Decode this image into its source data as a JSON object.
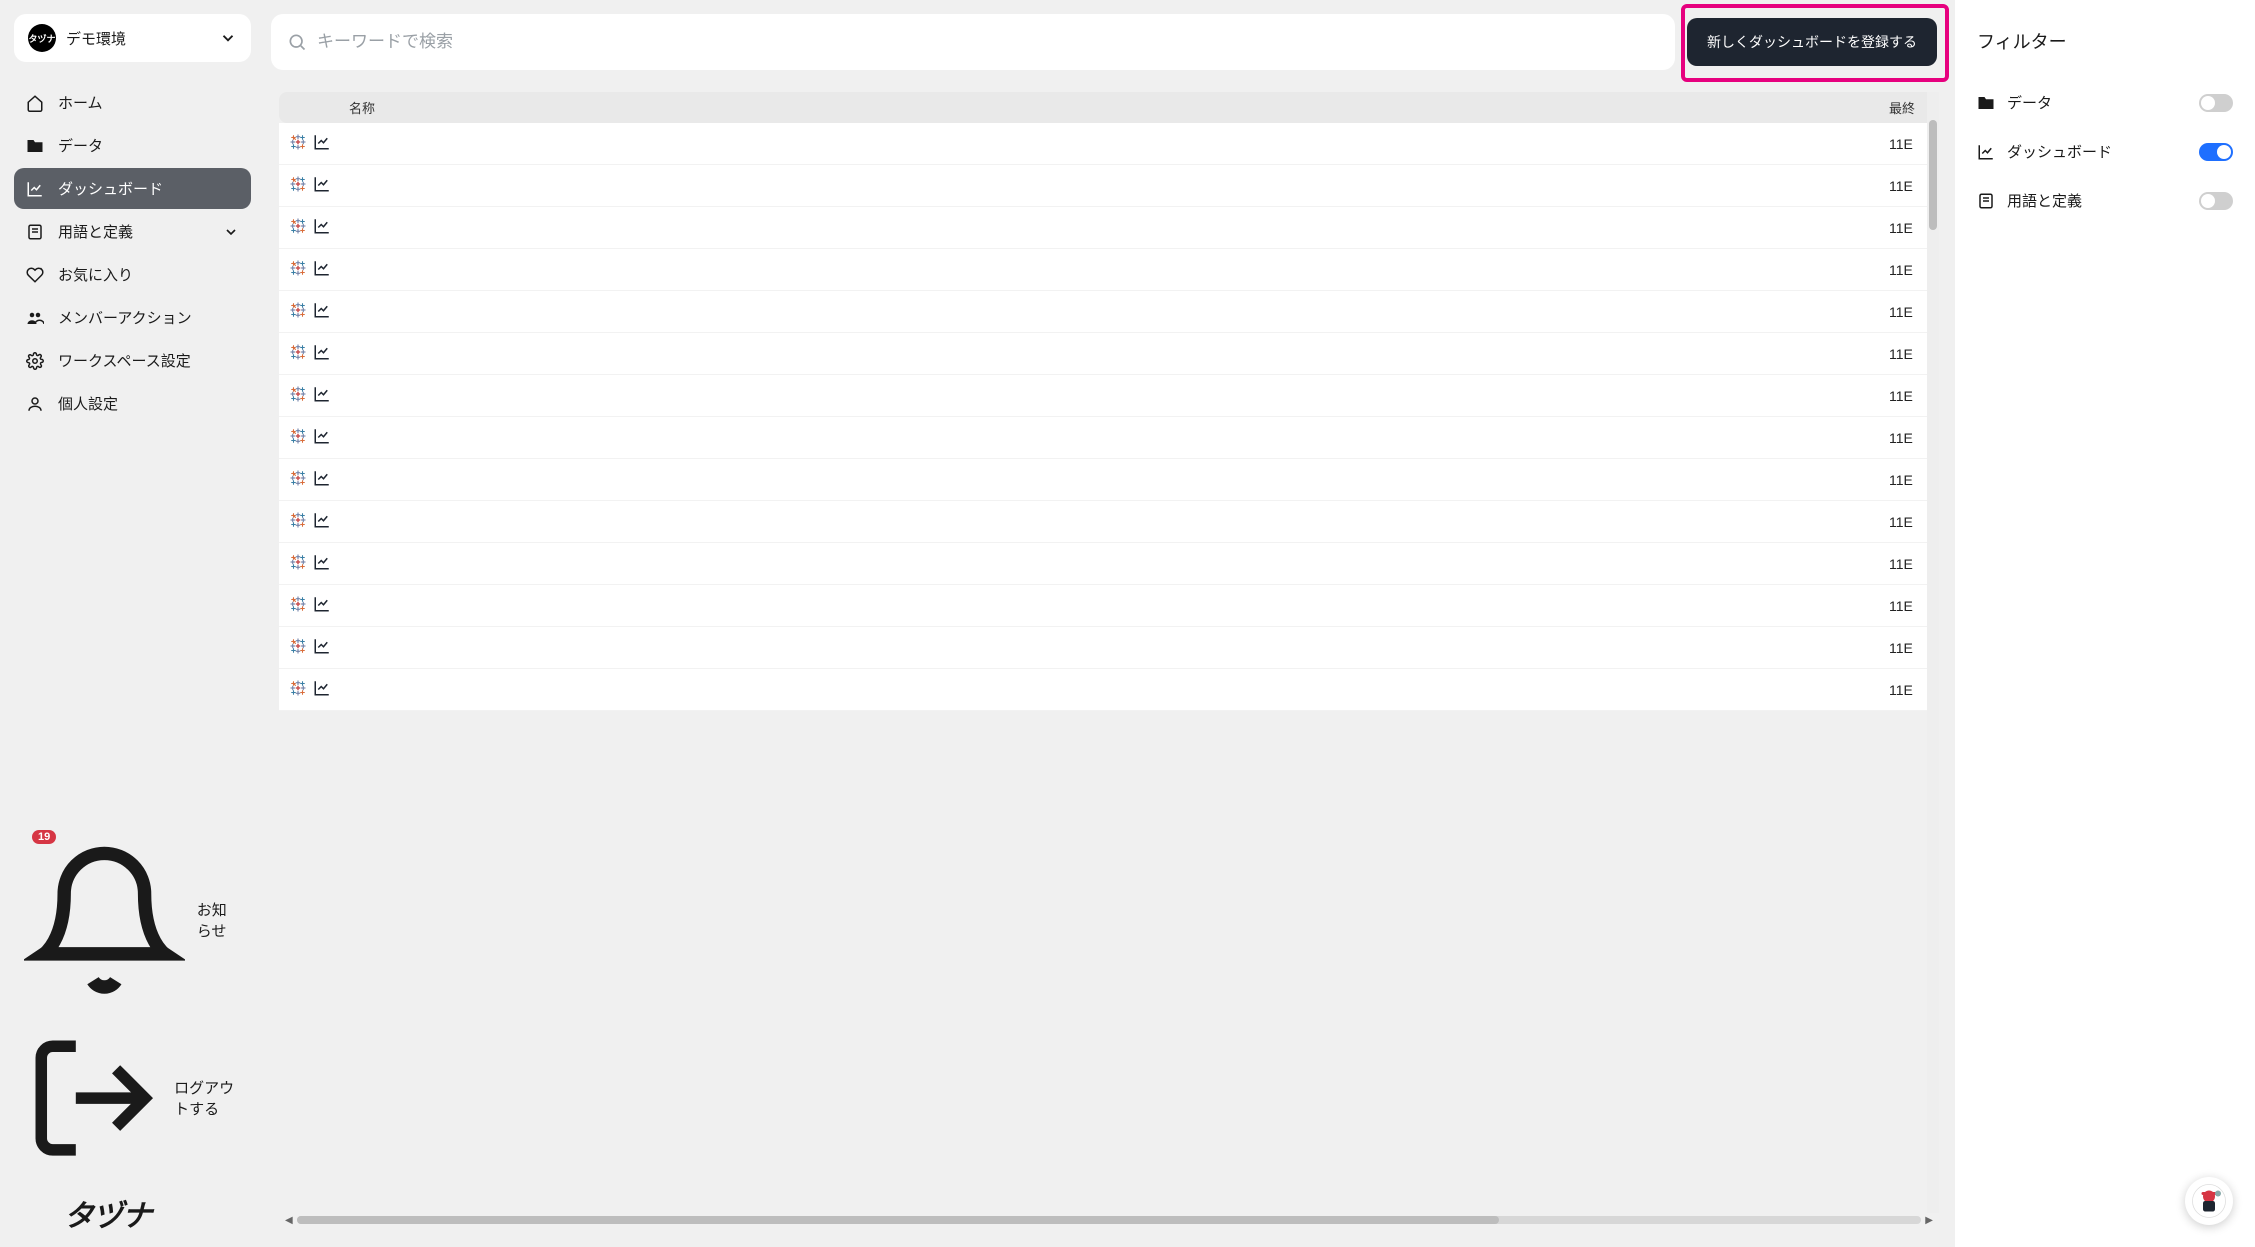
{
  "workspace": {
    "badge_text": "タヅナ",
    "name": "デモ環境"
  },
  "sidebar": {
    "items": [
      {
        "key": "home",
        "label": "ホーム",
        "active": false
      },
      {
        "key": "data",
        "label": "データ",
        "active": false
      },
      {
        "key": "dashboard",
        "label": "ダッシュボード",
        "active": true
      },
      {
        "key": "glossary",
        "label": "用語と定義",
        "active": false,
        "expandable": true
      },
      {
        "key": "favorites",
        "label": "お気に入り",
        "active": false
      },
      {
        "key": "member-actions",
        "label": "メンバーアクション",
        "active": false
      },
      {
        "key": "workspace-settings",
        "label": "ワークスペース設定",
        "active": false
      },
      {
        "key": "personal-settings",
        "label": "個人設定",
        "active": false
      }
    ],
    "notifications": {
      "label": "お知らせ",
      "count": "19"
    },
    "logout": {
      "label": "ログアウトする"
    },
    "logo": "タヅナ"
  },
  "search": {
    "placeholder": "キーワードで検索"
  },
  "register_button": {
    "label": "新しくダッシュボードを登録する"
  },
  "table": {
    "columns": {
      "name": "名称",
      "updated": "最終"
    },
    "rows": [
      {
        "date": "11E"
      },
      {
        "date": "11E"
      },
      {
        "date": "11E"
      },
      {
        "date": "11E"
      },
      {
        "date": "11E"
      },
      {
        "date": "11E"
      },
      {
        "date": "11E"
      },
      {
        "date": "11E"
      },
      {
        "date": "11E"
      },
      {
        "date": "11E"
      },
      {
        "date": "11E"
      },
      {
        "date": "11E"
      },
      {
        "date": "11E"
      },
      {
        "date": "11E"
      }
    ]
  },
  "filters": {
    "title": "フィルター",
    "items": [
      {
        "key": "data",
        "label": "データ",
        "on": false
      },
      {
        "key": "dashboard",
        "label": "ダッシュボード",
        "on": true
      },
      {
        "key": "glossary",
        "label": "用語と定義",
        "on": false
      }
    ]
  }
}
